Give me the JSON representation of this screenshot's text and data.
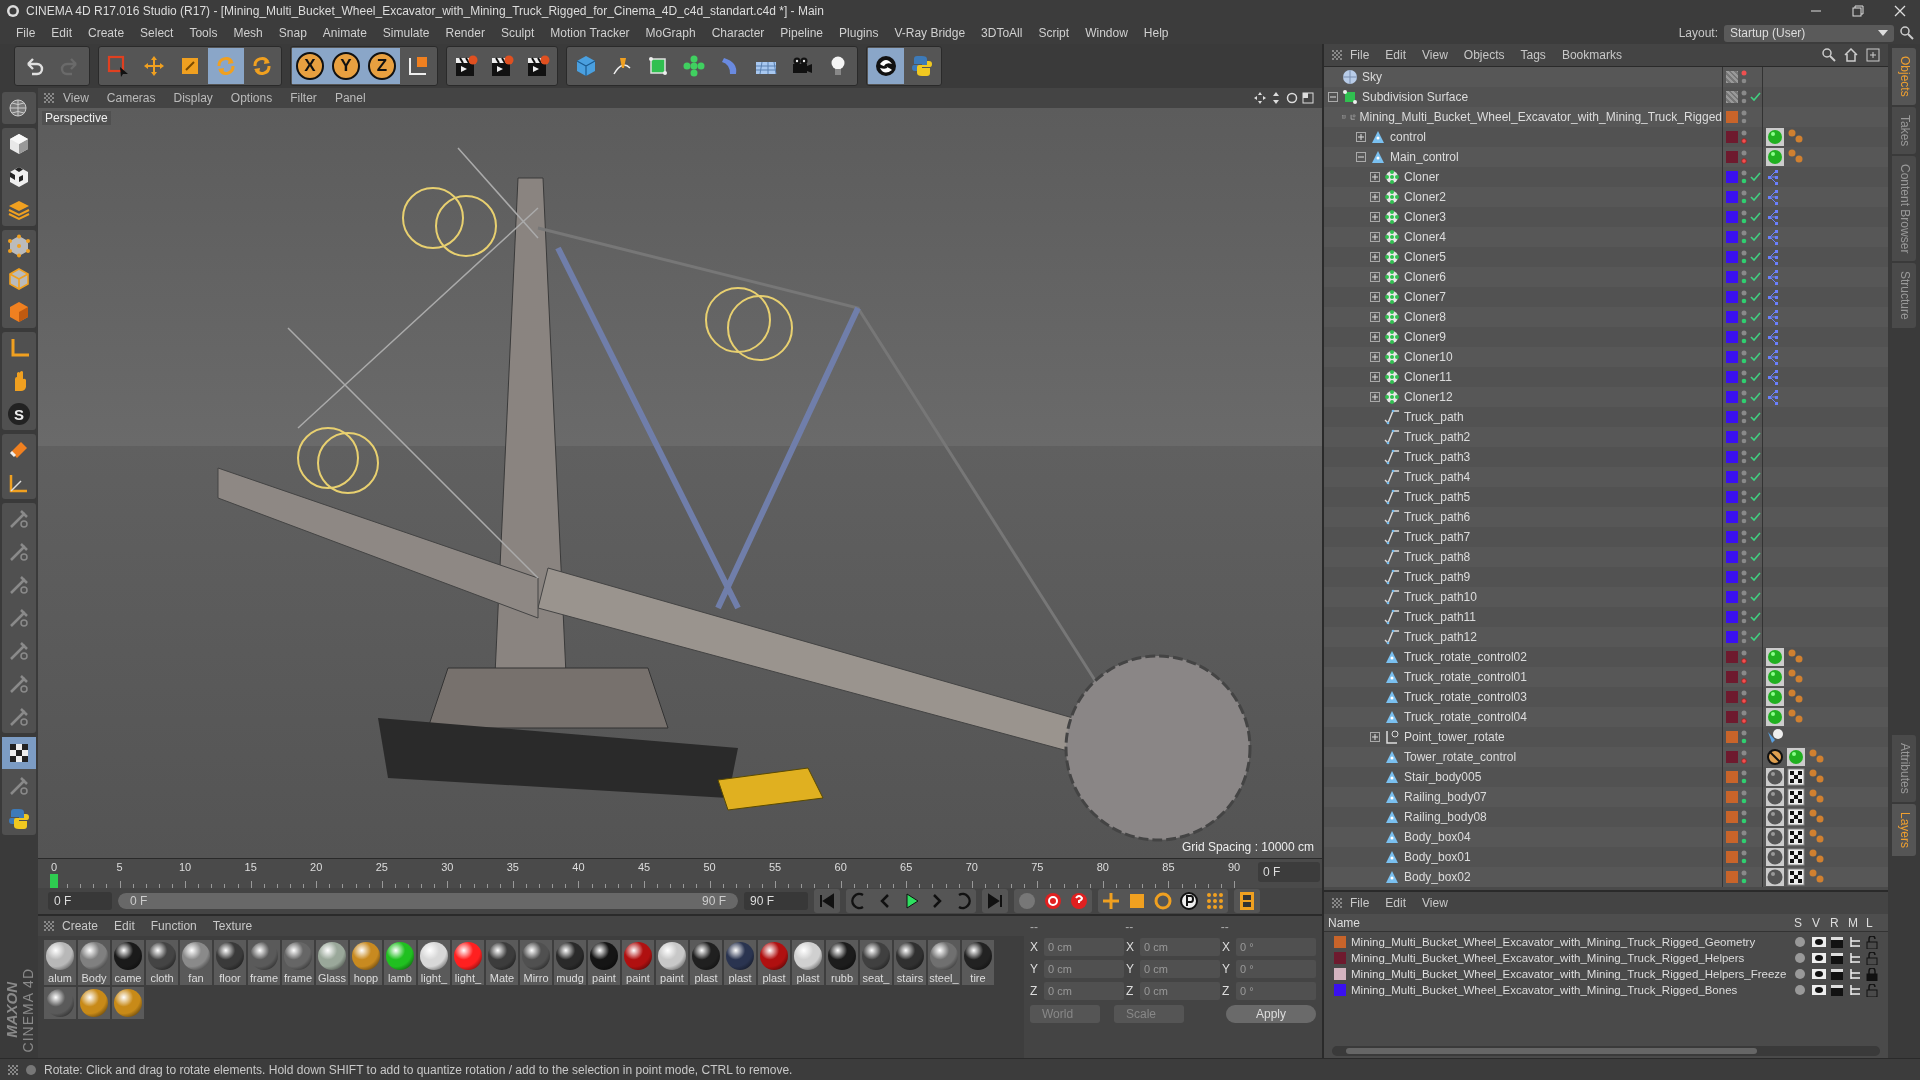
{
  "window": {
    "title": "CINEMA 4D R17.016 Studio (R17) - [Mining_Multi_Bucket_Wheel_Excavator_with_Mining_Truck_Rigged_for_Cinema_4D_c4d_standart.c4d *] - Main"
  },
  "menu": [
    "File",
    "Edit",
    "Create",
    "Select",
    "Tools",
    "Mesh",
    "Snap",
    "Animate",
    "Simulate",
    "Render",
    "Sculpt",
    "Motion Tracker",
    "MoGraph",
    "Character",
    "Pipeline",
    "Plugins",
    "V-Ray Bridge",
    "3DToAll",
    "Script",
    "Window",
    "Help"
  ],
  "layout": {
    "label": "Layout:",
    "value": "Startup (User)"
  },
  "toolbar": [
    [
      {
        "kind": "undo",
        "selected": false
      },
      {
        "kind": "redo",
        "selected": false
      }
    ],
    [
      {
        "kind": "select",
        "selected": false
      },
      {
        "kind": "move",
        "selected": false
      },
      {
        "kind": "scale",
        "selected": false
      },
      {
        "kind": "rotate",
        "selected": true
      },
      {
        "kind": "recent",
        "selected": false
      }
    ],
    [
      {
        "kind": "axis",
        "label": "X",
        "selected": true
      },
      {
        "kind": "axis",
        "label": "Y",
        "selected": true
      },
      {
        "kind": "axis",
        "label": "Z",
        "selected": true
      },
      {
        "kind": "coords",
        "selected": false
      }
    ],
    [
      {
        "kind": "render",
        "selected": false
      },
      {
        "kind": "render",
        "selected": false
      },
      {
        "kind": "render",
        "selected": false
      }
    ],
    [
      {
        "kind": "cube",
        "selected": false
      },
      {
        "kind": "pen",
        "selected": false
      },
      {
        "kind": "subdivision",
        "selected": false
      },
      {
        "kind": "cloner",
        "selected": false
      },
      {
        "kind": "deformer",
        "selected": false
      },
      {
        "kind": "floor",
        "selected": false
      },
      {
        "kind": "camera",
        "selected": false
      },
      {
        "kind": "light",
        "selected": false
      }
    ],
    [
      {
        "kind": "sculpt",
        "selected": true
      },
      {
        "kind": "python",
        "selected": false
      }
    ]
  ],
  "side_tools": [
    [
      {
        "kind": "globe",
        "selected": false
      }
    ],
    [
      {
        "kind": "model",
        "selected": false
      },
      {
        "kind": "uv",
        "selected": false
      },
      {
        "kind": "texture",
        "selected": false
      }
    ],
    [
      {
        "kind": "points",
        "selected": false
      },
      {
        "kind": "edges",
        "selected": false
      },
      {
        "kind": "polygons",
        "selected": false
      }
    ],
    [
      {
        "kind": "axis",
        "selected": false
      },
      {
        "kind": "tweak",
        "selected": false
      },
      {
        "kind": "snap",
        "label": "S",
        "selected": false
      }
    ],
    [
      {
        "kind": "magnet",
        "selected": false
      },
      {
        "kind": "workplane",
        "selected": false
      }
    ],
    [
      {
        "kind": "dim",
        "selected": false
      },
      {
        "kind": "dim",
        "selected": false
      },
      {
        "kind": "dim",
        "selected": false
      },
      {
        "kind": "dim",
        "selected": false
      },
      {
        "kind": "dim",
        "selected": false
      },
      {
        "kind": "dim",
        "selected": false
      },
      {
        "kind": "dim",
        "selected": false
      }
    ],
    [
      {
        "kind": "grid",
        "selected": true
      },
      {
        "kind": "dim",
        "selected": false
      },
      {
        "kind": "python",
        "selected": false
      }
    ]
  ],
  "viewport": {
    "menu": [
      "View",
      "Cameras",
      "Display",
      "Options",
      "Filter",
      "Panel"
    ],
    "camera": "Perspective",
    "grid_spacing": "Grid Spacing : 10000 cm"
  },
  "timeline": {
    "ticks": [
      "0",
      "5",
      "10",
      "15",
      "20",
      "25",
      "30",
      "35",
      "40",
      "45",
      "50",
      "55",
      "60",
      "65",
      "70",
      "75",
      "80",
      "85",
      "90"
    ],
    "level": 0,
    "current_frame": "0 F",
    "start_frame": "0 F",
    "range": {
      "start": "0 F",
      "end": "90 F",
      "level": 1
    },
    "end_frame": "90 F"
  },
  "materials": {
    "menu": [
      "Create",
      "Edit",
      "Function",
      "Texture"
    ],
    "items": [
      {
        "name": "alum",
        "color": "#b8b8b8"
      },
      {
        "name": "Body",
        "color": "#808080"
      },
      {
        "name": "came",
        "color": "#1a1a1a"
      },
      {
        "name": "cloth",
        "color": "#444444"
      },
      {
        "name": "fan",
        "color": "#8a8a8a"
      },
      {
        "name": "floor",
        "color": "#3a3a3a"
      },
      {
        "name": "frame",
        "color": "#5a5a5a"
      },
      {
        "name": "frame",
        "color": "#666666"
      },
      {
        "name": "Glass",
        "color": "#9aa89a"
      },
      {
        "name": "hopp",
        "color": "#c88a20"
      },
      {
        "name": "lamb",
        "color": "#20c020"
      },
      {
        "name": "light_",
        "color": "#d8d8d8"
      },
      {
        "name": "light_",
        "color": "#ff2020"
      },
      {
        "name": "Mate",
        "color": "#3c3c3c"
      },
      {
        "name": "Mirro",
        "color": "#505050"
      },
      {
        "name": "mudg",
        "color": "#2a2a2a"
      },
      {
        "name": "paint",
        "color": "#151515"
      },
      {
        "name": "paint",
        "color": "#b01010"
      },
      {
        "name": "paint",
        "color": "#c8c8c8"
      },
      {
        "name": "plast",
        "color": "#202020"
      },
      {
        "name": "plast",
        "color": "#2a3450"
      },
      {
        "name": "plast",
        "color": "#b01010"
      },
      {
        "name": "plast",
        "color": "#d0d0d0"
      },
      {
        "name": "rubb",
        "color": "#1c1c1c"
      },
      {
        "name": "seat_",
        "color": "#404040"
      },
      {
        "name": "stairs",
        "color": "#303030"
      },
      {
        "name": "steel_",
        "color": "#707070"
      },
      {
        "name": "tire",
        "color": "#222222"
      },
      {
        "color": "#5a5a5a"
      },
      {
        "color": "#c88a18"
      },
      {
        "color": "#c88a18"
      }
    ]
  },
  "coordinates": {
    "headers": [
      "--",
      "--",
      "--"
    ],
    "rows": [
      {
        "cells": [
          {
            "label": "X",
            "value": "0 cm"
          },
          {
            "label": "X",
            "value": "0 cm"
          },
          {
            "label": "X",
            "value": "0 °"
          }
        ]
      },
      {
        "cells": [
          {
            "label": "Y",
            "value": "0 cm"
          },
          {
            "label": "Y",
            "value": "0 cm"
          },
          {
            "label": "Y",
            "value": "0 °"
          }
        ]
      },
      {
        "cells": [
          {
            "label": "Z",
            "value": "0 cm"
          },
          {
            "label": "Z",
            "value": "0 cm"
          },
          {
            "label": "Z",
            "value": "0 °"
          }
        ]
      }
    ],
    "modes": [
      "World",
      "Scale"
    ],
    "apply": "Apply"
  },
  "objects": {
    "menu": [
      "File",
      "Edit",
      "View",
      "Objects",
      "Tags",
      "Bookmarks"
    ],
    "items": [
      {
        "name": "Sky",
        "kind": "sky",
        "editor_off": true,
        "render_on": false,
        "render_off": false,
        "enabled": false
      },
      {
        "name": "Subdivision Surface",
        "kind": "subdivision",
        "editor_off": false,
        "render_on": false,
        "render_off": false,
        "enabled": true,
        "expanded": true,
        "children": [
          {
            "name": "Mining_Multi_Bucket_Wheel_Excavator_with_Mining_Truck_Rigged",
            "kind": "null",
            "color": "#c8642a",
            "editor_off": false,
            "render_on": false,
            "render_off": false,
            "enabled": false,
            "expanded": true,
            "children": [
              {
                "name": "control",
                "kind": "joint",
                "color": "#6e1a2e",
                "editor_off": false,
                "render_on": false,
                "render_off": true,
                "enabled": false,
                "tags": [
                  {
                    "kind": "display"
                  },
                  {
                    "kind": "weight"
                  }
                ],
                "expanded": false
              },
              {
                "name": "Main_control",
                "kind": "joint",
                "color": "#6e1a2e",
                "editor_off": false,
                "render_on": false,
                "render_off": true,
                "enabled": false,
                "tags": [
                  {
                    "kind": "display"
                  },
                  {
                    "kind": "weight"
                  }
                ],
                "expanded": true,
                "children": [
                  {
                    "name": "Cloner",
                    "kind": "cloner",
                    "color": "#3a10f0",
                    "editor_off": false,
                    "render_on": true,
                    "render_off": false,
                    "enabled": true,
                    "tags": [
                      {
                        "kind": "cluster"
                      }
                    ],
                    "expanded": false
                  },
                  {
                    "name": "Cloner2",
                    "kind": "cloner",
                    "color": "#3a10f0",
                    "editor_off": false,
                    "render_on": true,
                    "render_off": false,
                    "enabled": true,
                    "tags": [
                      {
                        "kind": "cluster"
                      }
                    ],
                    "expanded": false
                  },
                  {
                    "name": "Cloner3",
                    "kind": "cloner",
                    "color": "#3a10f0",
                    "editor_off": false,
                    "render_on": true,
                    "render_off": false,
                    "enabled": true,
                    "tags": [
                      {
                        "kind": "cluster"
                      }
                    ],
                    "expanded": false
                  },
                  {
                    "name": "Cloner4",
                    "kind": "cloner",
                    "color": "#3a10f0",
                    "editor_off": false,
                    "render_on": true,
                    "render_off": false,
                    "enabled": true,
                    "tags": [
                      {
                        "kind": "cluster"
                      }
                    ],
                    "expanded": false
                  },
                  {
                    "name": "Cloner5",
                    "kind": "cloner",
                    "color": "#3a10f0",
                    "editor_off": false,
                    "render_on": true,
                    "render_off": false,
                    "enabled": true,
                    "tags": [
                      {
                        "kind": "cluster"
                      }
                    ],
                    "expanded": false
                  },
                  {
                    "name": "Cloner6",
                    "kind": "cloner",
                    "color": "#3a10f0",
                    "editor_off": false,
                    "render_on": true,
                    "render_off": false,
                    "enabled": true,
                    "tags": [
                      {
                        "kind": "cluster"
                      }
                    ],
                    "expanded": false
                  },
                  {
                    "name": "Cloner7",
                    "kind": "cloner",
                    "color": "#3a10f0",
                    "editor_off": false,
                    "render_on": true,
                    "render_off": false,
                    "enabled": true,
                    "tags": [
                      {
                        "kind": "cluster"
                      }
                    ],
                    "expanded": false
                  },
                  {
                    "name": "Cloner8",
                    "kind": "cloner",
                    "color": "#3a10f0",
                    "editor_off": false,
                    "render_on": true,
                    "render_off": false,
                    "enabled": true,
                    "tags": [
                      {
                        "kind": "cluster"
                      }
                    ],
                    "expanded": false
                  },
                  {
                    "name": "Cloner9",
                    "kind": "cloner",
                    "color": "#3a10f0",
                    "editor_off": false,
                    "render_on": true,
                    "render_off": false,
                    "enabled": true,
                    "tags": [
                      {
                        "kind": "cluster"
                      }
                    ],
                    "expanded": false
                  },
                  {
                    "name": "Cloner10",
                    "kind": "cloner",
                    "color": "#3a10f0",
                    "editor_off": false,
                    "render_on": true,
                    "render_off": false,
                    "enabled": true,
                    "tags": [
                      {
                        "kind": "cluster"
                      }
                    ],
                    "expanded": false
                  },
                  {
                    "name": "Cloner11",
                    "kind": "cloner",
                    "color": "#3a10f0",
                    "editor_off": false,
                    "render_on": true,
                    "render_off": false,
                    "enabled": true,
                    "tags": [
                      {
                        "kind": "cluster"
                      }
                    ],
                    "expanded": false
                  },
                  {
                    "name": "Cloner12",
                    "kind": "cloner",
                    "color": "#3a10f0",
                    "editor_off": false,
                    "render_on": true,
                    "render_off": false,
                    "enabled": true,
                    "tags": [
                      {
                        "kind": "cluster"
                      }
                    ],
                    "expanded": false
                  },
                  {
                    "name": "Truck_path",
                    "kind": "spline",
                    "color": "#3a10f0",
                    "editor_off": false,
                    "render_on": false,
                    "render_off": false,
                    "enabled": true
                  },
                  {
                    "name": "Truck_path2",
                    "kind": "spline",
                    "color": "#3a10f0",
                    "editor_off": false,
                    "render_on": false,
                    "render_off": false,
                    "enabled": true
                  },
                  {
                    "name": "Truck_path3",
                    "kind": "spline",
                    "color": "#3a10f0",
                    "editor_off": false,
                    "render_on": false,
                    "render_off": false,
                    "enabled": true
                  },
                  {
                    "name": "Truck_path4",
                    "kind": "spline",
                    "color": "#3a10f0",
                    "editor_off": false,
                    "render_on": false,
                    "render_off": false,
                    "enabled": true
                  },
                  {
                    "name": "Truck_path5",
                    "kind": "spline",
                    "color": "#3a10f0",
                    "editor_off": false,
                    "render_on": false,
                    "render_off": false,
                    "enabled": true
                  },
                  {
                    "name": "Truck_path6",
                    "kind": "spline",
                    "color": "#3a10f0",
                    "editor_off": false,
                    "render_on": false,
                    "render_off": false,
                    "enabled": true
                  },
                  {
                    "name": "Truck_path7",
                    "kind": "spline",
                    "color": "#3a10f0",
                    "editor_off": false,
                    "render_on": false,
                    "render_off": false,
                    "enabled": true
                  },
                  {
                    "name": "Truck_path8",
                    "kind": "spline",
                    "color": "#3a10f0",
                    "editor_off": false,
                    "render_on": false,
                    "render_off": false,
                    "enabled": true
                  },
                  {
                    "name": "Truck_path9",
                    "kind": "spline",
                    "color": "#3a10f0",
                    "editor_off": false,
                    "render_on": false,
                    "render_off": false,
                    "enabled": true
                  },
                  {
                    "name": "Truck_path10",
                    "kind": "spline",
                    "color": "#3a10f0",
                    "editor_off": false,
                    "render_on": false,
                    "render_off": false,
                    "enabled": true
                  },
                  {
                    "name": "Truck_path11",
                    "kind": "spline",
                    "color": "#3a10f0",
                    "editor_off": false,
                    "render_on": false,
                    "render_off": false,
                    "enabled": true
                  },
                  {
                    "name": "Truck_path12",
                    "kind": "spline",
                    "color": "#3a10f0",
                    "editor_off": false,
                    "render_on": false,
                    "render_off": false,
                    "enabled": true
                  },
                  {
                    "name": "Truck_rotate_control02",
                    "kind": "joint",
                    "color": "#6e1a2e",
                    "editor_off": false,
                    "render_on": false,
                    "render_off": true,
                    "enabled": false,
                    "tags": [
                      {
                        "kind": "display"
                      },
                      {
                        "kind": "weight"
                      }
                    ]
                  },
                  {
                    "name": "Truck_rotate_control01",
                    "kind": "joint",
                    "color": "#6e1a2e",
                    "editor_off": false,
                    "render_on": false,
                    "render_off": true,
                    "enabled": false,
                    "tags": [
                      {
                        "kind": "display"
                      },
                      {
                        "kind": "weight"
                      }
                    ]
                  },
                  {
                    "name": "Truck_rotate_control03",
                    "kind": "joint",
                    "color": "#6e1a2e",
                    "editor_off": false,
                    "render_on": false,
                    "render_off": true,
                    "enabled": false,
                    "tags": [
                      {
                        "kind": "display"
                      },
                      {
                        "kind": "weight"
                      }
                    ]
                  },
                  {
                    "name": "Truck_rotate_control04",
                    "kind": "joint",
                    "color": "#6e1a2e",
                    "editor_off": false,
                    "render_on": false,
                    "render_off": true,
                    "enabled": false,
                    "tags": [
                      {
                        "kind": "display"
                      },
                      {
                        "kind": "weight"
                      }
                    ]
                  },
                  {
                    "name": "Point_tower_rotate",
                    "kind": "null",
                    "color": "#c8642a",
                    "editor_off": false,
                    "render_on": true,
                    "render_off": false,
                    "enabled": false,
                    "tags": [
                      {
                        "kind": "target"
                      }
                    ],
                    "expanded": false
                  },
                  {
                    "name": "Tower_rotate_control",
                    "kind": "joint",
                    "color": "#6e1a2e",
                    "editor_off": false,
                    "render_on": false,
                    "render_off": true,
                    "enabled": false,
                    "tags": [
                      {
                        "kind": "protect"
                      },
                      {
                        "kind": "display"
                      },
                      {
                        "kind": "weight"
                      }
                    ]
                  },
                  {
                    "name": "Stair_body005",
                    "kind": "joint",
                    "color": "#c8642a",
                    "editor_off": false,
                    "render_on": true,
                    "render_off": false,
                    "enabled": false,
                    "tags": [
                      {
                        "kind": "material"
                      },
                      {
                        "kind": "uvw"
                      },
                      {
                        "kind": "weight"
                      }
                    ]
                  },
                  {
                    "name": "Railing_body07",
                    "kind": "joint",
                    "color": "#c8642a",
                    "editor_off": false,
                    "render_on": true,
                    "render_off": false,
                    "enabled": false,
                    "tags": [
                      {
                        "kind": "material"
                      },
                      {
                        "kind": "uvw"
                      },
                      {
                        "kind": "weight"
                      }
                    ]
                  },
                  {
                    "name": "Railing_body08",
                    "kind": "joint",
                    "color": "#c8642a",
                    "editor_off": false,
                    "render_on": true,
                    "render_off": false,
                    "enabled": false,
                    "tags": [
                      {
                        "kind": "material"
                      },
                      {
                        "kind": "uvw"
                      },
                      {
                        "kind": "weight"
                      }
                    ]
                  },
                  {
                    "name": "Body_box04",
                    "kind": "joint",
                    "color": "#c8642a",
                    "editor_off": false,
                    "render_on": true,
                    "render_off": false,
                    "enabled": false,
                    "tags": [
                      {
                        "kind": "material"
                      },
                      {
                        "kind": "uvw"
                      },
                      {
                        "kind": "weight"
                      }
                    ]
                  },
                  {
                    "name": "Body_box01",
                    "kind": "joint",
                    "color": "#c8642a",
                    "editor_off": false,
                    "render_on": true,
                    "render_off": false,
                    "enabled": false,
                    "tags": [
                      {
                        "kind": "material"
                      },
                      {
                        "kind": "uvw"
                      },
                      {
                        "kind": "weight"
                      }
                    ]
                  },
                  {
                    "name": "Body_box02",
                    "kind": "joint",
                    "color": "#c8642a",
                    "editor_off": false,
                    "render_on": true,
                    "render_off": false,
                    "enabled": false,
                    "tags": [
                      {
                        "kind": "material"
                      },
                      {
                        "kind": "uvw"
                      },
                      {
                        "kind": "weight"
                      }
                    ]
                  }
                ]
              }
            ]
          }
        ]
      }
    ]
  },
  "layers": {
    "menu": [
      "File",
      "Edit",
      "View"
    ],
    "columns": [
      "Name",
      "S",
      "V",
      "R",
      "M",
      "L"
    ],
    "rows": [
      {
        "name": "Mining_Multi_Bucket_Wheel_Excavator_with_Mining_Truck_Rigged_Geometry",
        "color": "#c8642a",
        "locked": false
      },
      {
        "name": "Mining_Multi_Bucket_Wheel_Excavator_with_Mining_Truck_Rigged_Helpers",
        "color": "#6e1a2e",
        "locked": false
      },
      {
        "name": "Mining_Multi_Bucket_Wheel_Excavator_with_Mining_Truck_Rigged_Helpers_Freeze",
        "color": "#d4b4c0",
        "locked": true
      },
      {
        "name": "Mining_Multi_Bucket_Wheel_Excavator_with_Mining_Truck_Rigged_Bones",
        "color": "#3a10f0",
        "locked": false
      }
    ]
  },
  "side_tabs": {
    "top": [
      {
        "label": "Objects",
        "selected": true
      },
      {
        "label": "Takes",
        "selected": false
      },
      {
        "label": "Content Browser",
        "selected": false
      },
      {
        "label": "Structure",
        "selected": false
      }
    ],
    "bottom": [
      {
        "label": "Attributes",
        "selected": false
      },
      {
        "label": "Layers",
        "selected": true
      }
    ]
  },
  "brand": {
    "maker": "MAXON",
    "product": "CINEMA 4D"
  },
  "status_bar": {
    "text": "Rotate: Click and drag to rotate elements. Hold down SHIFT to add to quantize rotation / add to the selection in point mode, CTRL to remove."
  }
}
